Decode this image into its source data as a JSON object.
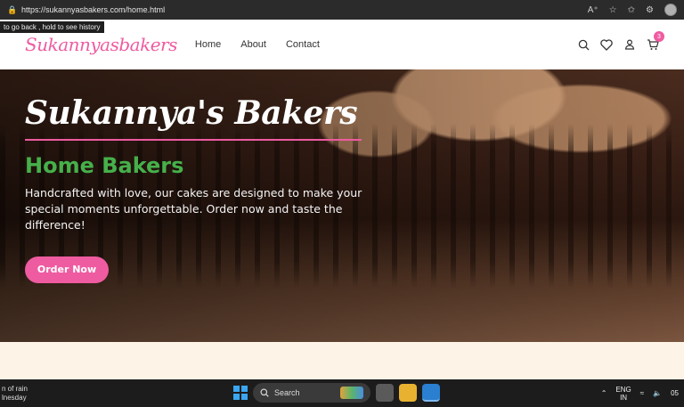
{
  "browser": {
    "url": "https://sukannyasbakers.com/home.html",
    "tooltip": "to go back , hold to see history"
  },
  "header": {
    "logo": "Sukannyasbakers",
    "nav": [
      "Home",
      "About",
      "Contact"
    ],
    "cart_count": "3"
  },
  "hero": {
    "title": "Sukannya's Bakers",
    "subtitle": "Home Bakers",
    "description": "Handcrafted with love, our cakes are designed to make your special moments unforgettable. Order now and taste the difference!",
    "cta_label": "Order Now"
  },
  "taskbar": {
    "weather_line1": "n of rain",
    "weather_line2": "lnesday",
    "search_label": "Search",
    "lang_line1": "ENG",
    "lang_line2": "IN",
    "clock": "05"
  },
  "colors": {
    "brand_pink": "#ef5ba1",
    "accent_green": "#46b04a",
    "cream": "#fdf3e6"
  }
}
